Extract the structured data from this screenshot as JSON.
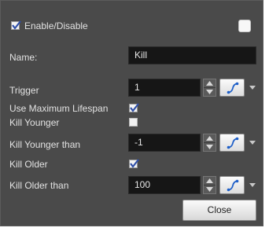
{
  "panel": {
    "enable": {
      "label": "Enable/Disable",
      "checked": true
    },
    "name": {
      "label": "Name:",
      "value": "Kill"
    },
    "trigger": {
      "label": "Trigger",
      "value": "1"
    },
    "use_max_lifespan": {
      "label": "Use Maximum Lifespan",
      "checked": true
    },
    "kill_younger": {
      "label": "Kill Younger",
      "checked": false
    },
    "kill_younger_than": {
      "label": "Kill Younger than",
      "value": "-1"
    },
    "kill_older": {
      "label": "Kill Older",
      "checked": true
    },
    "kill_older_than": {
      "label": "Kill Older than",
      "value": "100"
    },
    "close_label": "Close"
  },
  "icons": {
    "checkmark": "checkmark-icon",
    "spin_up": "spin-up-arrow-icon",
    "spin_down": "spin-down-arrow-icon",
    "function_curve": "function-curve-icon",
    "dropdown": "dropdown-arrow-icon"
  },
  "colors": {
    "panel_bg": "#4a4a4a",
    "field_bg": "#161616",
    "checkmark": "#2f4fa8",
    "curve_icon": "#1e5fc8"
  }
}
